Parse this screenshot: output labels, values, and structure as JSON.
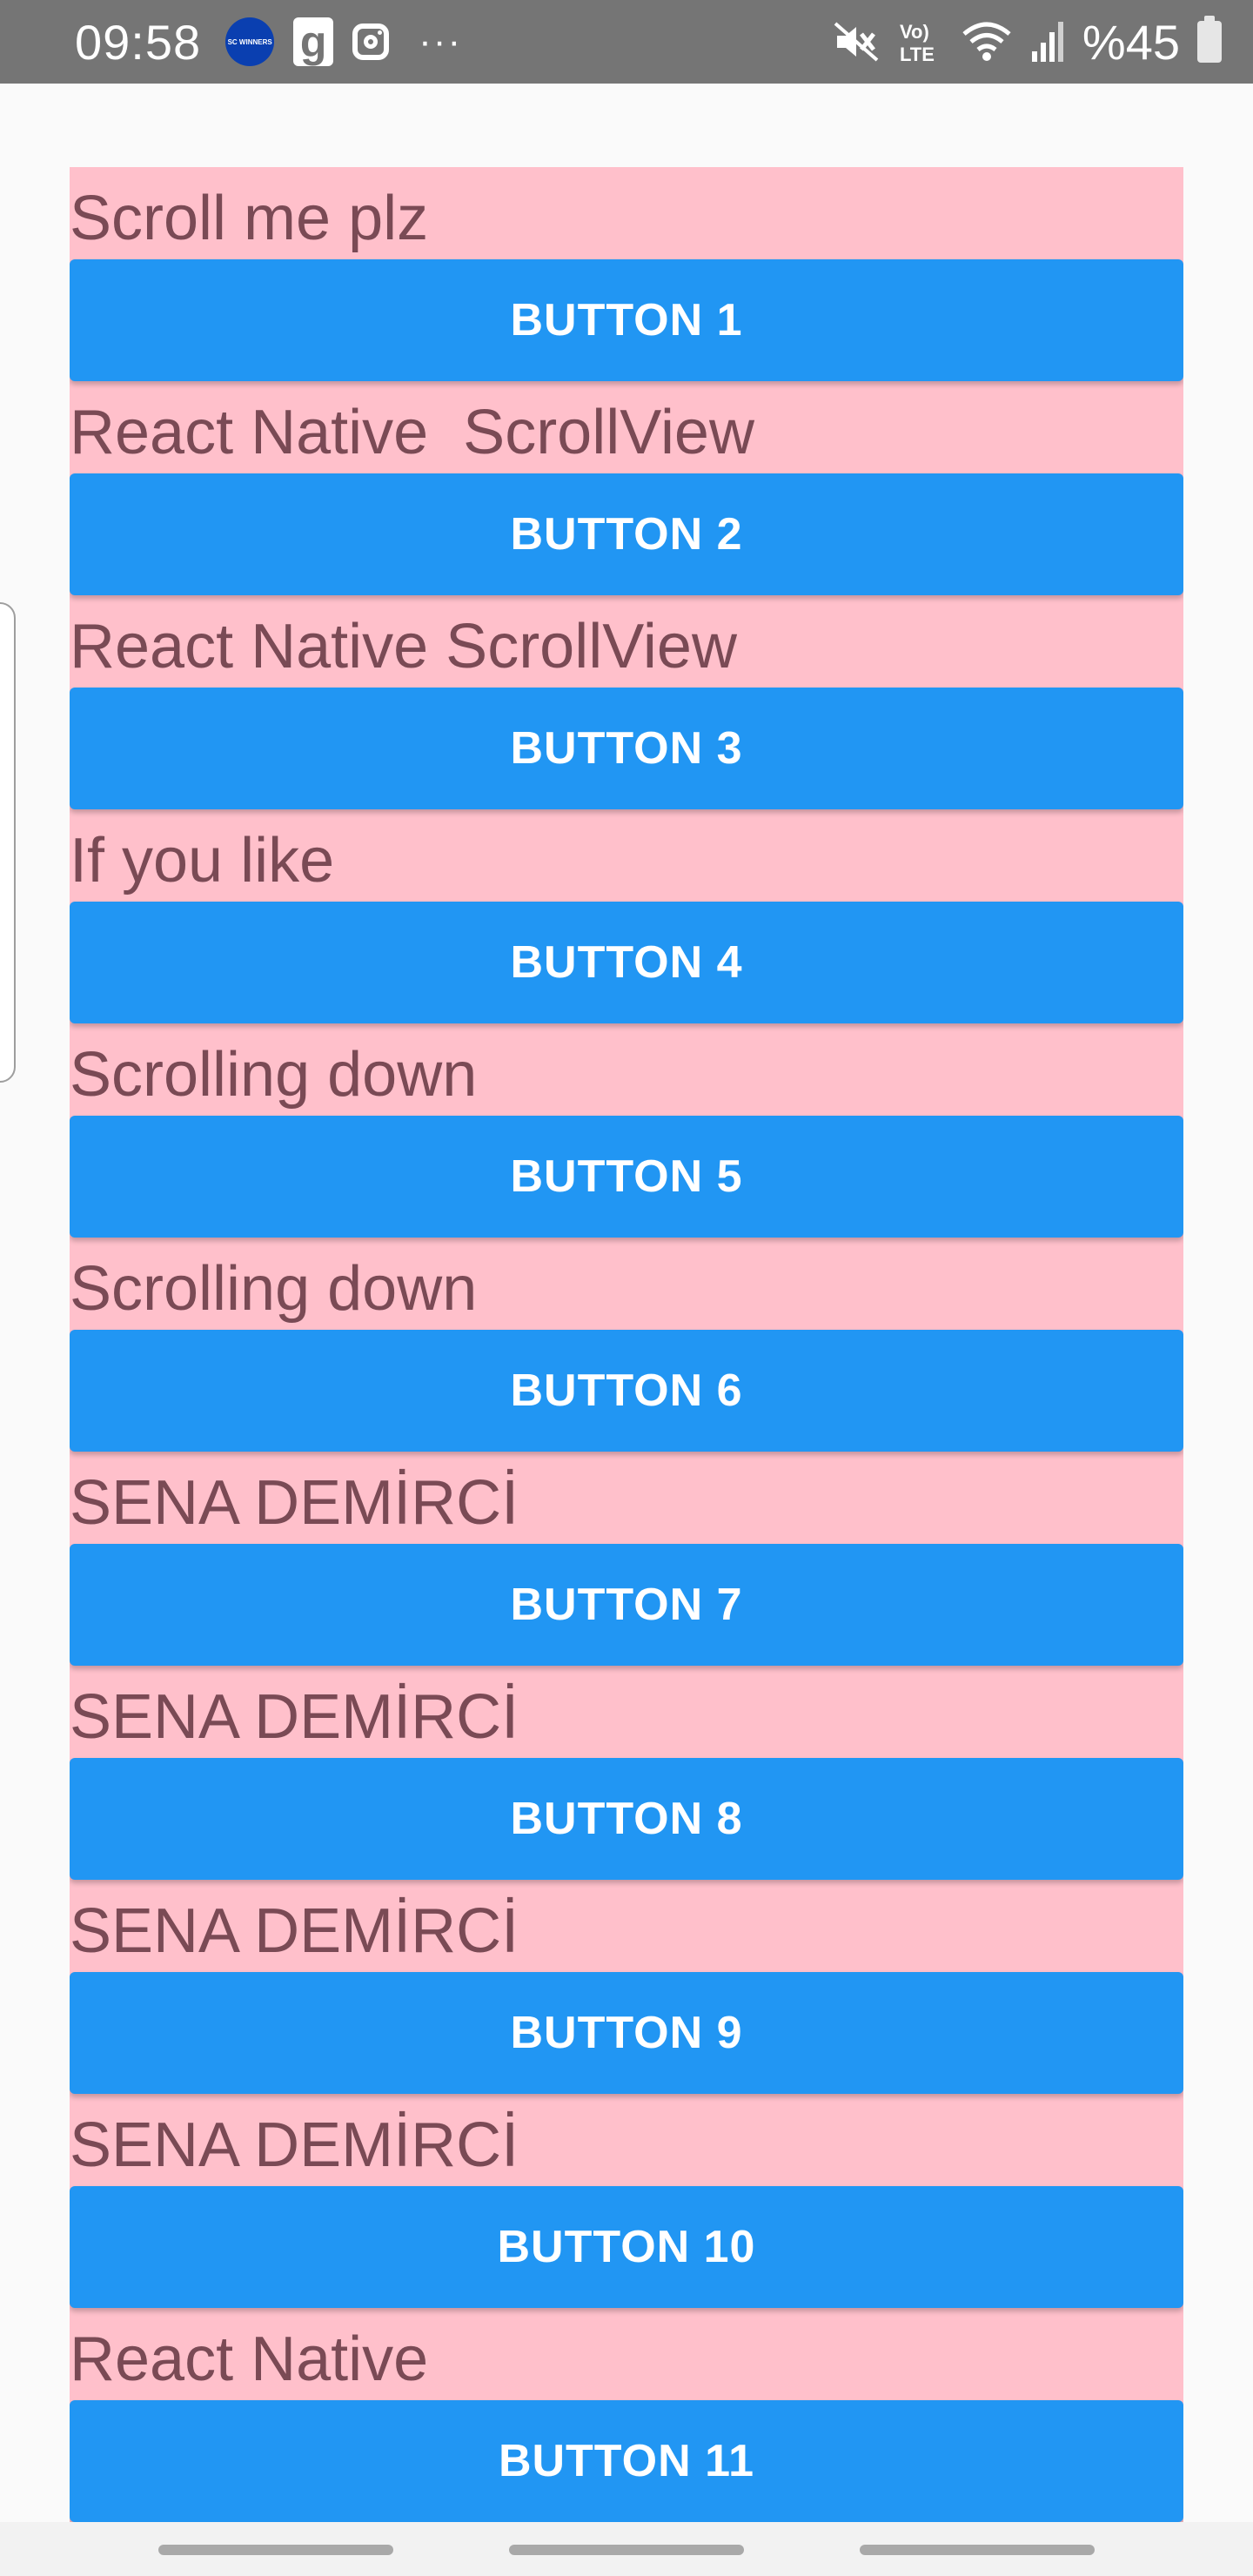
{
  "status_bar": {
    "time": "09:58",
    "app_badge_text": "SC WINNERS",
    "g_icon_text": "g",
    "more": "···",
    "battery_percent": "%45",
    "icons": [
      "app-badge-icon",
      "g-app-icon",
      "instagram-icon",
      "mute-icon",
      "volte-icon",
      "wifi-icon",
      "signal-icon",
      "battery-icon"
    ]
  },
  "scroll_view": {
    "background": "#ffc0cb",
    "button_color": "#2196f3",
    "items": [
      {
        "text": "Scroll me plz",
        "button": "BUTTON 1"
      },
      {
        "text": "React Native  ScrollView",
        "button": "BUTTON 2"
      },
      {
        "text": "React Native ScrollView",
        "button": "BUTTON 3"
      },
      {
        "text": "If you like",
        "button": "BUTTON 4"
      },
      {
        "text": "Scrolling down",
        "button": "BUTTON 5"
      },
      {
        "text": "Scrolling down",
        "button": "BUTTON 6"
      },
      {
        "text": "SENA DEMİRCİ",
        "button": "BUTTON 7"
      },
      {
        "text": "SENA DEMİRCİ",
        "button": "BUTTON 8"
      },
      {
        "text": "SENA DEMİRCİ",
        "button": "BUTTON 9"
      },
      {
        "text": "SENA DEMİRCİ",
        "button": "BUTTON 10"
      },
      {
        "text": "React Native",
        "button": "BUTTON 11"
      }
    ]
  }
}
